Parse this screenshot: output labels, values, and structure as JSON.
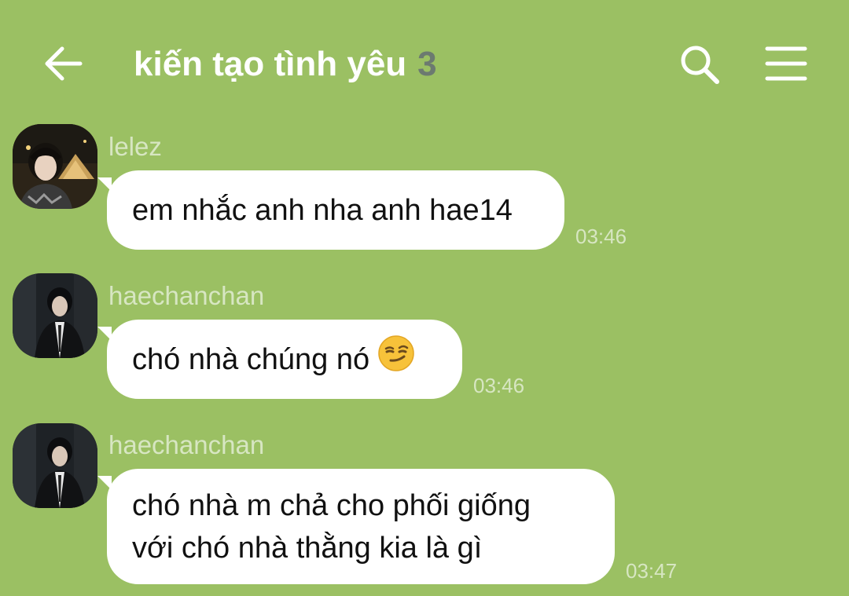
{
  "header": {
    "title": "kiến tạo tình yêu",
    "member_count": "3",
    "icons": {
      "back": "back-arrow-icon",
      "search": "search-icon",
      "menu": "menu-icon"
    }
  },
  "messages": [
    {
      "sender": "lelez",
      "text": "em nhắc anh nha anh hae14",
      "time": "03:46",
      "avatar": "avatar-lelez"
    },
    {
      "sender": "haechanchan",
      "text": "chó nhà chúng nó",
      "emoji": "smirking-face-emoji",
      "time": "03:46",
      "avatar": "avatar-haechanchan"
    },
    {
      "sender": "haechanchan",
      "text": "chó nhà m chả cho phối giống\nvới chó nhà thằng kia là gì",
      "time": "03:47",
      "avatar": "avatar-haechanchan"
    }
  ],
  "colors": {
    "background": "#9bc063",
    "bubble": "#ffffff",
    "meta_text": "#d7e6c2",
    "count": "#6c7a70"
  }
}
